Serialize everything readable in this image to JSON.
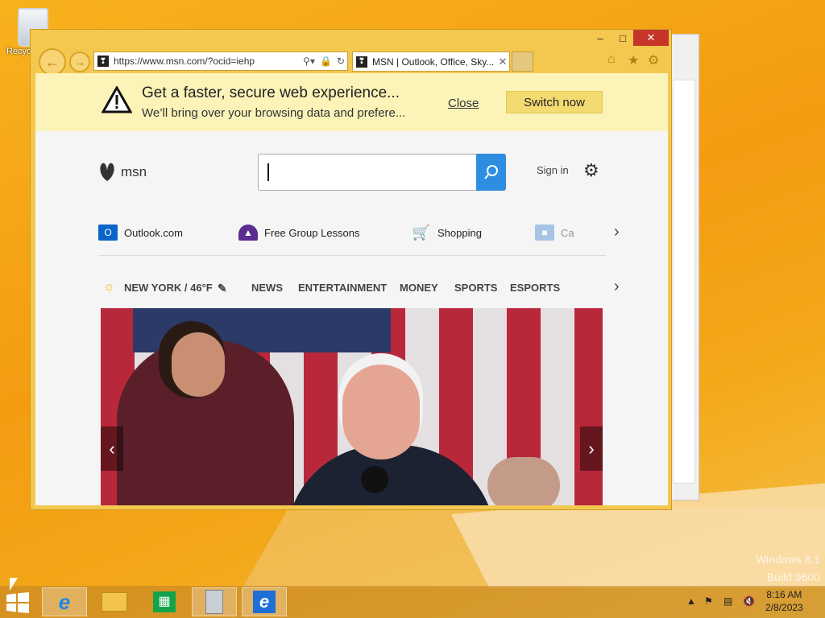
{
  "desktop": {
    "recycle_bin_label": "Recyc",
    "watermark_line1": "Windows 8.1",
    "watermark_line2": "Build 9600"
  },
  "browser": {
    "address_url": "https://www.msn.com/?ocid=iehp",
    "tab_title": "MSN | Outlook, Office, Sky...",
    "window_controls": {
      "minimize": "–",
      "maximize": "□",
      "close": "✕"
    }
  },
  "notification": {
    "title": "Get a faster, secure web experience...",
    "subtitle": "We’ll bring over your browsing data and prefere...",
    "close_label": "Close",
    "switch_label": "Switch now"
  },
  "msn": {
    "logo_text": "msn",
    "search_placeholder": "",
    "sign_in": "Sign in"
  },
  "quick_links": [
    {
      "label": "Outlook.com",
      "icon": "outlook-icon",
      "color": "#0a64c8"
    },
    {
      "label": "Free Group Lessons",
      "icon": "graduation-cap-icon",
      "color": "#5b2c91"
    },
    {
      "label": "Shopping",
      "icon": "shopping-cart-icon",
      "color": "#1a6fd6"
    },
    {
      "label": "Ca",
      "icon": "car-icon",
      "color": "#4a8ad0"
    }
  ],
  "categories": {
    "weather": "NEW YORK / 46°F",
    "items": [
      "NEWS",
      "ENTERTAINMENT",
      "MONEY",
      "SPORTS",
      "ESPORTS"
    ]
  },
  "taskbar": {
    "time": "8:16 AM",
    "date": "2/8/2023"
  },
  "colors": {
    "desktop_bg": "#f49b12",
    "window_frame": "#f4c74f",
    "notification_bg": "#fbf3b8",
    "search_button": "#2d8de0"
  }
}
